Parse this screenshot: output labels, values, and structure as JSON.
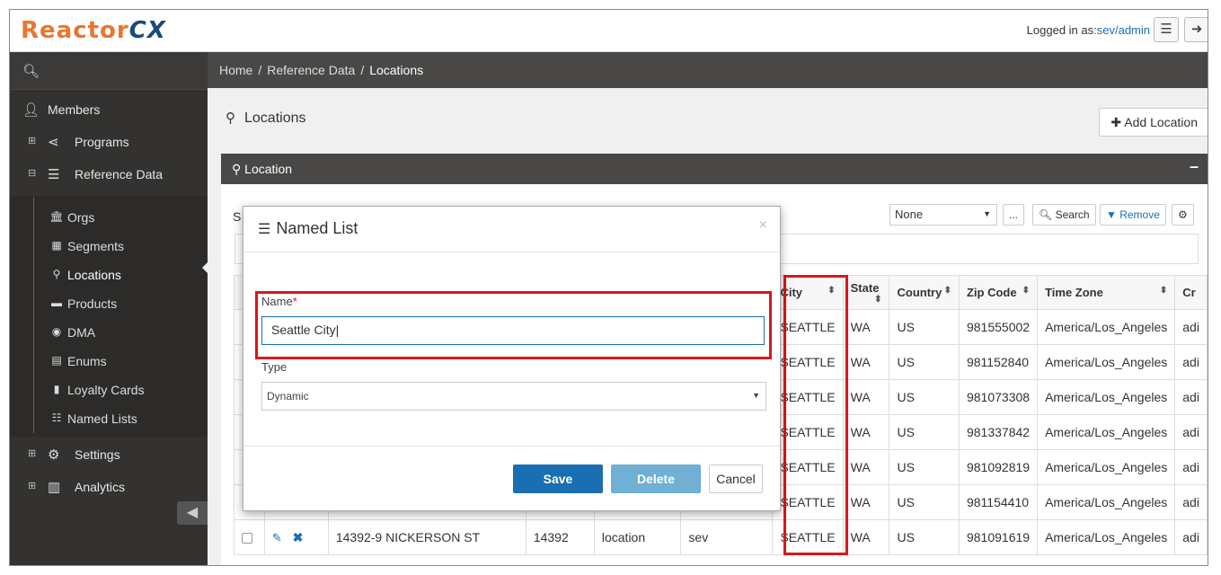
{
  "app": {
    "logo_main": "Reactor",
    "logo_cx": "CX",
    "logged_in_prefix": "Logged in as:",
    "logged_in_user": "sev/admin"
  },
  "sidebar": {
    "members": "Members",
    "programs": "Programs",
    "reference_data": "Reference Data",
    "sub_items": [
      "Orgs",
      "Segments",
      "Locations",
      "Products",
      "DMA",
      "Enums",
      "Loyalty Cards",
      "Named Lists"
    ],
    "settings": "Settings",
    "analytics": "Analytics",
    "expand_plus": "⊞",
    "expand_minus": "⊟"
  },
  "breadcrumb": {
    "home": "Home",
    "reference_data": "Reference Data",
    "current": "Locations",
    "separator": "/"
  },
  "page": {
    "title": "Locations",
    "add_button": "Add Location"
  },
  "panel": {
    "title": "Location",
    "minimize": "–",
    "partial_s": "S"
  },
  "toolbar": {
    "select_value": "None",
    "ellipsis": "...",
    "search": "Search",
    "remove": "Remove"
  },
  "table": {
    "headers": [
      "City",
      "State",
      "Country",
      "Zip Code",
      "Time Zone",
      "Cr"
    ],
    "rows": [
      {
        "city": "SEATTLE",
        "state": "WA",
        "country": "US",
        "zip": "981555002",
        "tz": "America/Los_Angeles",
        "cr": "adi"
      },
      {
        "city": "SEATTLE",
        "state": "WA",
        "country": "US",
        "zip": "981152840",
        "tz": "America/Los_Angeles",
        "cr": "adi"
      },
      {
        "city": "SEATTLE",
        "state": "WA",
        "country": "US",
        "zip": "981073308",
        "tz": "America/Los_Angeles",
        "cr": "adi"
      },
      {
        "city": "SEATTLE",
        "state": "WA",
        "country": "US",
        "zip": "981337842",
        "tz": "America/Los_Angeles",
        "cr": "adi"
      },
      {
        "city": "SEATTLE",
        "state": "WA",
        "country": "US",
        "zip": "981092819",
        "tz": "America/Los_Angeles",
        "cr": "adi"
      },
      {
        "city": "SEATTLE",
        "state": "WA",
        "country": "US",
        "zip": "981154410",
        "tz": "America/Los_Angeles",
        "cr": "adi"
      },
      {
        "city": "SEATTLE",
        "state": "WA",
        "country": "US",
        "zip": "981091619",
        "tz": "America/Los_Angeles",
        "cr": "adi"
      }
    ],
    "last_row_extra": {
      "address": "14392-9 NICKERSON ST",
      "number": "14392",
      "type": "location",
      "owner": "sev"
    }
  },
  "modal": {
    "title": "Named List",
    "close": "×",
    "name_label": "Name",
    "required_mark": "*",
    "name_value": "Seattle City",
    "type_label": "Type",
    "type_value": "Dynamic",
    "save": "Save",
    "delete": "Delete",
    "cancel": "Cancel"
  },
  "colors": {
    "accent": "#1a6fb3",
    "highlight": "#d9171b",
    "sidebar_bg": "#333230",
    "header_bg": "#4a4846"
  }
}
